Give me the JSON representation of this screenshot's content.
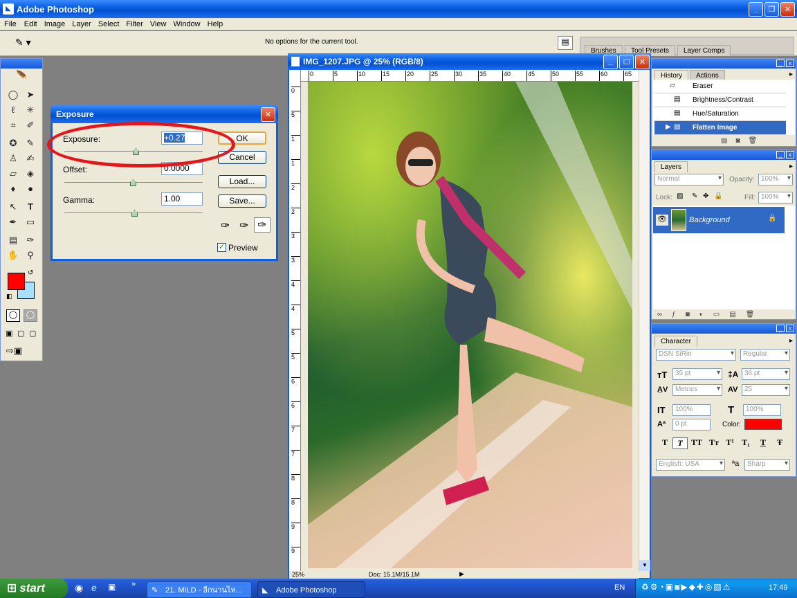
{
  "app": {
    "title": "Adobe Photoshop",
    "menu": [
      "File",
      "Edit",
      "Image",
      "Layer",
      "Select",
      "Filter",
      "View",
      "Window",
      "Help"
    ],
    "options_text": "No options for the current tool.",
    "dock_tabs": [
      "Brushes",
      "Tool Presets",
      "Layer Comps"
    ]
  },
  "document": {
    "title": "IMG_1207.JPG @ 25% (RGB/8)",
    "ruler_labels": [
      "0",
      "5",
      "10",
      "15",
      "20",
      "25",
      "30",
      "35",
      "40",
      "45",
      "50",
      "55",
      "60",
      "65"
    ],
    "vruler_labels": [
      "0",
      "5",
      "1",
      "1",
      "2",
      "2",
      "3",
      "3",
      "4",
      "4",
      "5",
      "5",
      "6",
      "6",
      "7",
      "7",
      "8",
      "8",
      "9",
      "9"
    ],
    "zoom": "25%",
    "doc_info": "Doc: 15.1M/15.1M"
  },
  "exposure_dialog": {
    "title": "Exposure",
    "exposure_label": "Exposure:",
    "exposure_value": "+0.27",
    "offset_label": "Offset:",
    "offset_value": "0.0000",
    "gamma_label": "Gamma:",
    "gamma_value": "1.00",
    "ok": "OK",
    "cancel": "Cancel",
    "load": "Load...",
    "save": "Save...",
    "preview_label": "Preview",
    "preview_checked": true,
    "exposure_slider": 0.52,
    "offset_slider": 0.5,
    "gamma_slider": 0.51
  },
  "history_panel": {
    "tabs": [
      "History",
      "Actions"
    ],
    "items": [
      "Eraser",
      "Brightness/Contrast",
      "Hue/Saturation",
      "Flatten Image"
    ],
    "selected_index": 3
  },
  "layers_panel": {
    "tab": "Layers",
    "blend_mode": "Normal",
    "opacity_label": "Opacity:",
    "opacity_value": "100%",
    "lock_label": "Lock:",
    "fill_label": "Fill:",
    "fill_value": "100%",
    "layer_name": "Background"
  },
  "character_panel": {
    "tab": "Character",
    "font": "DSN SiRin",
    "style": "Regular",
    "size": "35 pt",
    "leading": "36 pt",
    "kerning": "Metrics",
    "tracking": "25",
    "vscale": "100%",
    "hscale": "100%",
    "baseline": "0 pt",
    "color_label": "Color:",
    "color_value": "#ff0000",
    "style_buttons": [
      "T",
      "T",
      "TT",
      "Tт",
      "T¹",
      "T₁",
      "T",
      "Ŧ"
    ],
    "language": "English: USA",
    "aa_label": "a",
    "antialias": "Sharp"
  },
  "taskbar": {
    "start": "start",
    "items": [
      "21. MILD - อีกนานไห...",
      "Adobe Photoshop"
    ],
    "lang": "EN",
    "clock": "17:49"
  },
  "colors": {
    "foreground": "#ff0000",
    "background": "#a6e2ff",
    "xp_blue": "#0a5fe0",
    "highlight": "#316ac5"
  }
}
